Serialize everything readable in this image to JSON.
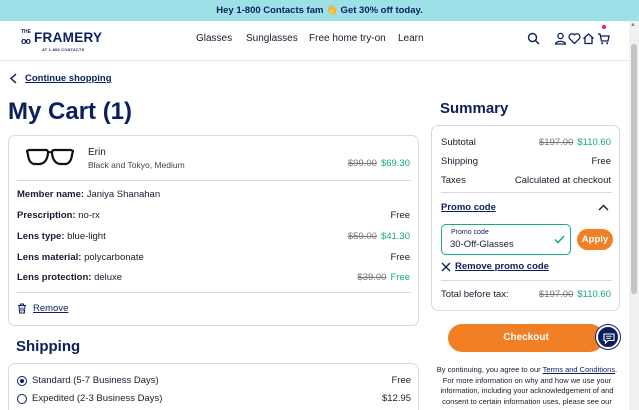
{
  "promo_banner": {
    "text": "Hey 1-800 Contacts fam 👋 Get 30% off today."
  },
  "header": {
    "logo": {
      "the": "THE",
      "oo": "oo",
      "wordmark": "FRAMERY",
      "sub": "AT 1-800 CONTACTS"
    },
    "nav": [
      {
        "label": "Glasses"
      },
      {
        "label": "Sunglasses"
      },
      {
        "label": "Free home try-on"
      },
      {
        "label": "Learn"
      }
    ],
    "icons": [
      "search-icon",
      "account-icon",
      "heart-icon",
      "home-icon",
      "cart-icon"
    ]
  },
  "back_link": {
    "label": "Continue shopping"
  },
  "cart": {
    "title": "My Cart (1)",
    "item": {
      "name": "Erin",
      "variant": "Black and Tokyo, Medium",
      "price_old": "$99.00",
      "price_new": "$69.30"
    },
    "member": {
      "label": "Member name:",
      "value": "Janiya Shanahan"
    },
    "details": [
      {
        "label": "Prescription:",
        "value": "no-rx",
        "price": "Free",
        "price_old": ""
      },
      {
        "label": "Lens type:",
        "value": "blue-light",
        "price": "$41.30",
        "price_old": "$59.00"
      },
      {
        "label": "Lens material:",
        "value": "polycarbonate",
        "price": "Free",
        "price_old": ""
      },
      {
        "label": "Lens protection:",
        "value": "deluxe",
        "price": "Free",
        "price_old": "$39.00"
      }
    ],
    "remove_label": "Remove"
  },
  "shipping": {
    "title": "Shipping",
    "options": [
      {
        "name": "Standard (5-7 Business Days)",
        "price": "Free",
        "selected": true
      },
      {
        "name": "Expedited (2-3 Business Days)",
        "price": "$12.95",
        "selected": false
      }
    ]
  },
  "summary": {
    "title": "Summary",
    "subtotal": {
      "label": "Subtotal",
      "old": "$197.00",
      "new": "$110.60"
    },
    "shipping": {
      "label": "Shipping",
      "value": "Free"
    },
    "taxes": {
      "label": "Taxes",
      "value": "Calculated at checkout"
    },
    "promo": {
      "toggle_label": "Promo code",
      "field_label": "Promo code",
      "value": "30-Off-Glasses",
      "apply_label": "Apply",
      "remove_label": "Remove promo code"
    },
    "total": {
      "label": "Total before tax:",
      "old": "$197.00",
      "new": "$110.60"
    },
    "checkout_label": "Checkout",
    "legal": {
      "before": "By continuing, you agree to our ",
      "link": "Terms and Conditions",
      "after": ". For more information on why and how we use your information, including your acknowledgement of and consent to certain information uses, please see our"
    }
  },
  "colors": {
    "brand_navy": "#0b1f5c",
    "accent_orange": "#f07f26",
    "sale_green": "#17a88a",
    "banner_teal": "#9ee0e8"
  }
}
